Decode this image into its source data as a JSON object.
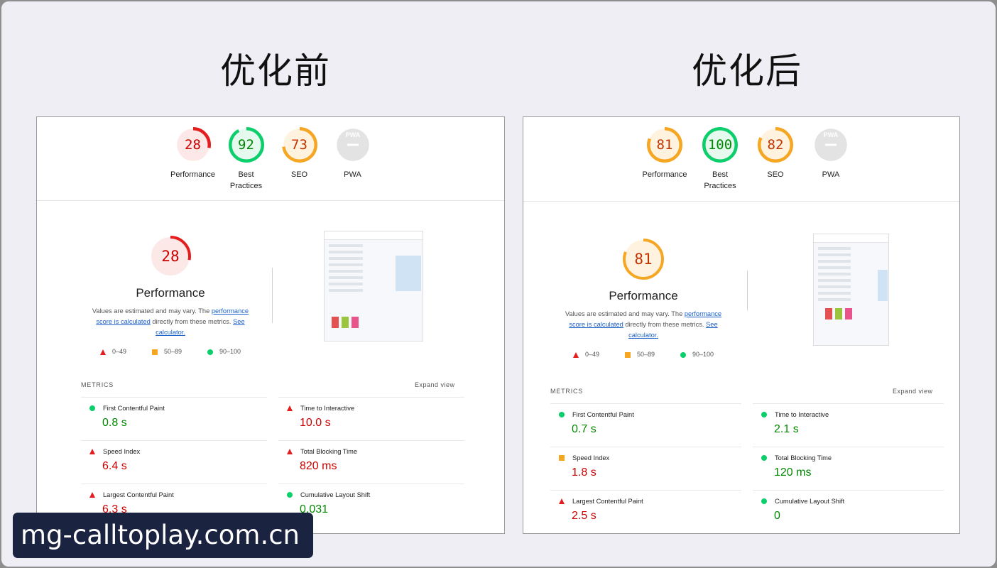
{
  "headings": {
    "before": "优化前",
    "after": "优化后"
  },
  "colors": {
    "fail": "#e41e1e",
    "average": "#f5a623",
    "pass": "#0cce6b",
    "fail_text": "#cc0000",
    "average_text": "#c33300",
    "pass_text": "#008800"
  },
  "before": {
    "gauges": [
      {
        "score": "28",
        "label": "Performance",
        "level": "fail",
        "fraction": 0.28
      },
      {
        "score": "92",
        "label": "Best Practices",
        "level": "pass",
        "fraction": 0.92
      },
      {
        "score": "73",
        "label": "SEO",
        "level": "average",
        "fraction": 0.73
      },
      {
        "score": "",
        "label": "PWA",
        "level": "na",
        "fraction": 0
      }
    ],
    "summary": {
      "score": "28",
      "fraction": 0.28,
      "level": "fail",
      "title": "Performance",
      "desc_text": "Values are estimated and may vary. The",
      "link1": "performance score is calculated",
      "desc_mid": "directly from these metrics.",
      "link2": "See calculator."
    },
    "legend": [
      "0–49",
      "50–89",
      "90–100"
    ],
    "metrics_title": "METRICS",
    "expand": "Expand view",
    "metrics": [
      {
        "name": "First Contentful Paint",
        "value": "0.8 s",
        "level": "pass"
      },
      {
        "name": "Time to Interactive",
        "value": "10.0 s",
        "level": "fail"
      },
      {
        "name": "Speed Index",
        "value": "6.4 s",
        "level": "fail"
      },
      {
        "name": "Total Blocking Time",
        "value": "820 ms",
        "level": "fail"
      },
      {
        "name": "Largest Contentful Paint",
        "value": "6.3 s",
        "level": "fail"
      },
      {
        "name": "Cumulative Layout Shift",
        "value": "0.031",
        "level": "pass"
      }
    ]
  },
  "after": {
    "gauges": [
      {
        "score": "81",
        "label": "Performance",
        "level": "average",
        "fraction": 0.81
      },
      {
        "score": "100",
        "label": "Best Practices",
        "level": "pass",
        "fraction": 1.0
      },
      {
        "score": "82",
        "label": "SEO",
        "level": "average",
        "fraction": 0.82
      },
      {
        "score": "",
        "label": "PWA",
        "level": "na",
        "fraction": 0
      }
    ],
    "summary": {
      "score": "81",
      "fraction": 0.81,
      "level": "average",
      "title": "Performance",
      "desc_text": "Values are estimated and may vary. The",
      "link1": "performance score is calculated",
      "desc_mid": "directly from these metrics.",
      "link2": "See calculator."
    },
    "legend": [
      "0–49",
      "50–89",
      "90–100"
    ],
    "metrics_title": "METRICS",
    "expand": "Expand view",
    "metrics": [
      {
        "name": "First Contentful Paint",
        "value": "0.7 s",
        "level": "pass"
      },
      {
        "name": "Time to Interactive",
        "value": "2.1 s",
        "level": "pass"
      },
      {
        "name": "Speed Index",
        "value": "1.8 s",
        "level": "average"
      },
      {
        "name": "Total Blocking Time",
        "value": "120 ms",
        "level": "pass"
      },
      {
        "name": "Largest Contentful Paint",
        "value": "2.5 s",
        "level": "fail"
      },
      {
        "name": "Cumulative Layout Shift",
        "value": "0",
        "level": "pass"
      }
    ]
  },
  "pwa_icon_label": "PWA",
  "watermark": "mg-calltoplay.com.cn"
}
